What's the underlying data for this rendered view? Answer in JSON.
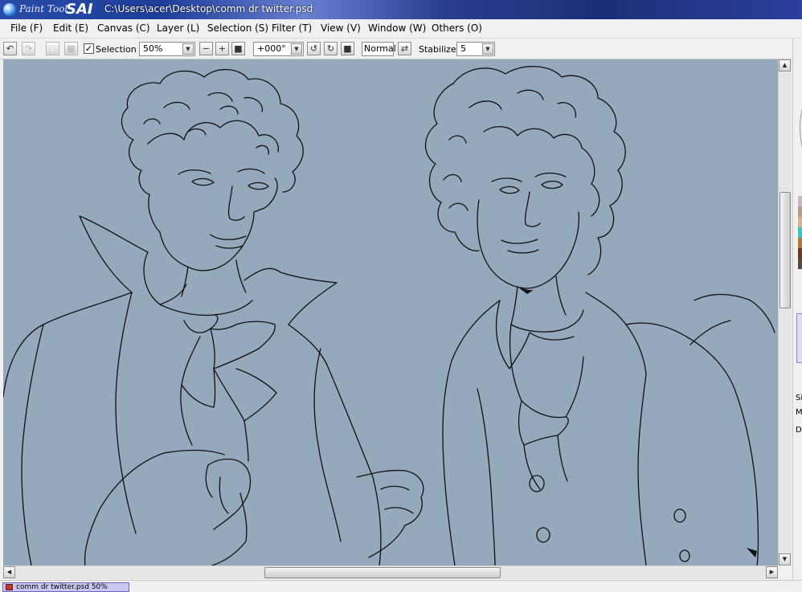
{
  "window": {
    "logo_text": "Paint Tool",
    "logo_sai": "SAI",
    "title": "C:\\Users\\acer\\Desktop\\comm dr twitter.psd"
  },
  "menu": [
    {
      "label": "File (F)"
    },
    {
      "label": "Edit (E)"
    },
    {
      "label": "Canvas (C)"
    },
    {
      "label": "Layer (L)"
    },
    {
      "label": "Selection (S)"
    },
    {
      "label": "Filter (T)"
    },
    {
      "label": "View (V)"
    },
    {
      "label": "Window (W)"
    },
    {
      "label": "Others (O)"
    }
  ],
  "toolbar": {
    "undo_icon": "undo-icon",
    "redo_icon": "redo-icon",
    "selection_label": "Selection",
    "selection_checked": true,
    "zoom_value": "50%",
    "rotation_value": "+000°",
    "blend_mode": "Normal",
    "stabilizer_label": "Stabilizer",
    "stabilizer_value": "5"
  },
  "right_panel": {
    "swatch_colors": [
      "#c9b7c9",
      "#b59a8e",
      "#d7b08a",
      "#36c4d4",
      "#b07a3a",
      "#6b3a1e",
      "#5a4a45"
    ],
    "labels": [
      "Si",
      "M",
      "De"
    ]
  },
  "statusbar": {
    "doc_tab": "comm dr twitter.psd  50%"
  },
  "colors": {
    "canvas_bg": "#94a9bb",
    "title_bar": "#2a4aa8",
    "doc_tab": "#c9c6f0"
  }
}
